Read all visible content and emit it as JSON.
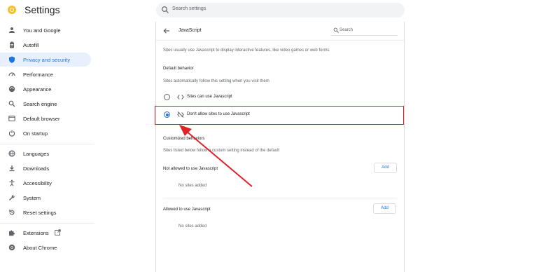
{
  "header": {
    "app_title": "Settings",
    "search_placeholder": "Search settings"
  },
  "sidebar": {
    "items": [
      {
        "label": "You and Google",
        "icon": "person-icon"
      },
      {
        "label": "Autofill",
        "icon": "clipboard-icon"
      },
      {
        "label": "Privacy and security",
        "icon": "shield-icon",
        "active": true
      },
      {
        "label": "Performance",
        "icon": "speedometer-icon"
      },
      {
        "label": "Appearance",
        "icon": "palette-icon"
      },
      {
        "label": "Search engine",
        "icon": "search-icon"
      },
      {
        "label": "Default browser",
        "icon": "browser-icon"
      },
      {
        "label": "On startup",
        "icon": "power-icon"
      },
      {
        "label": "Languages",
        "icon": "globe-icon"
      },
      {
        "label": "Downloads",
        "icon": "download-icon"
      },
      {
        "label": "Accessibility",
        "icon": "accessibility-icon"
      },
      {
        "label": "System",
        "icon": "wrench-icon"
      },
      {
        "label": "Reset settings",
        "icon": "reset-icon"
      },
      {
        "label": "Extensions",
        "icon": "puzzle-icon"
      },
      {
        "label": "About Chrome",
        "icon": "chrome-icon"
      }
    ]
  },
  "main": {
    "page_title": "JavaScript",
    "search_placeholder": "Search",
    "description": "Sites usually use Javascript to display interactive features, like video games or web forms",
    "default_behavior": {
      "heading": "Default behavior",
      "subtext": "Sites automatically follow this setting when you visit them",
      "options": [
        {
          "label": "Sites can use Javascript",
          "selected": false,
          "icon": "code-icon"
        },
        {
          "label": "Don't allow sites to use Javascript",
          "selected": true,
          "icon": "code-off-icon"
        }
      ]
    },
    "customized": {
      "heading": "Customized behaviors",
      "subtext": "Sites listed below follow a custom setting instead of the default",
      "not_allowed": {
        "label": "Not allowed to use Javascript",
        "add_label": "Add",
        "empty": "No sites added"
      },
      "allowed": {
        "label": "Allowed to use Javascript",
        "add_label": "Add",
        "empty": "No sites added"
      }
    }
  },
  "colors": {
    "accent": "#1a73e8",
    "highlight": "#e0222a"
  }
}
